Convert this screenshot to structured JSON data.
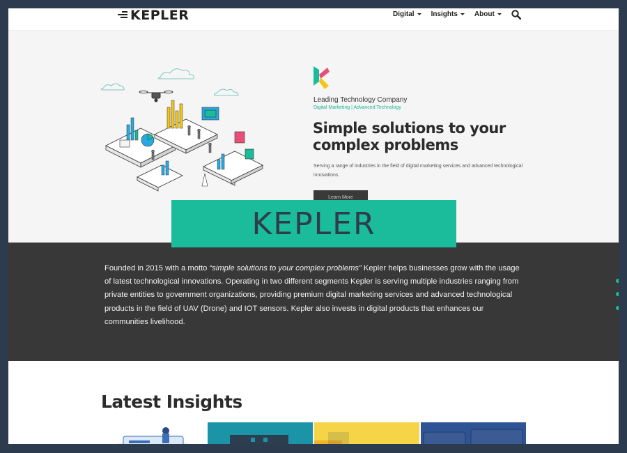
{
  "nav": {
    "logo": "KEPLER",
    "menu": [
      {
        "label": "Digital"
      },
      {
        "label": "Insights"
      },
      {
        "label": "About"
      }
    ]
  },
  "hero": {
    "company": "Leading Technology Company",
    "tagline": "Digital Marketing | Advanced Technology",
    "headline": "Simple solutions to your complex problems",
    "description": "Serving a range of industries in the field of digital marketing services and advanced technological innovations.",
    "button": "Learn More"
  },
  "banner": {
    "text": "KEPLER"
  },
  "about": {
    "intro": "Founded in 2015 with a motto ",
    "motto": "“simple solutions to your complex problems”",
    "body": "  Kepler helps businesses grow with the usage of latest technological innovations. Operating in two different segments Kepler is serving multiple industries ranging from private entities to government organizations, providing premium digital marketing services and advanced technological products in the field of UAV (Drone) and IOT sensors. Kepler also invests in digital products that enhances our communities livelihood."
  },
  "insights": {
    "title": "Latest Insights"
  },
  "colors": {
    "accent": "#1abc9c",
    "frame": "#2d3b4e",
    "dark": "#383838",
    "hero_bg": "#f5f5f5"
  }
}
